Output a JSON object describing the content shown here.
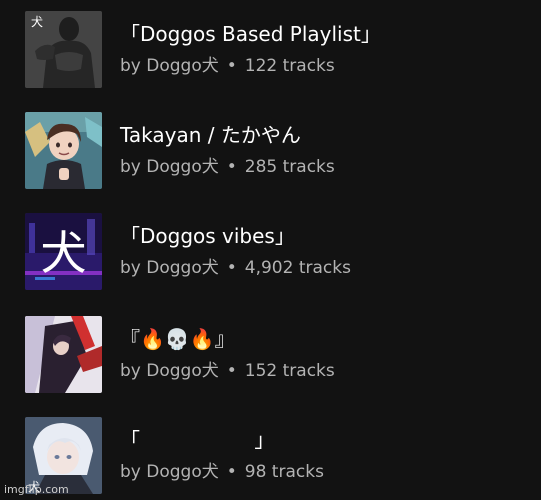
{
  "playlists": [
    {
      "title": "「Doggos Based Playlist」",
      "owner": "by Doggo犬",
      "separator": "•",
      "tracks": "122 tracks",
      "icon": "muscular-man-artwork"
    },
    {
      "title": "Takayan / たかやん",
      "owner": "by Doggo犬",
      "separator": "•",
      "tracks": "285 tracks",
      "icon": "anime-boy-artwork"
    },
    {
      "title": "「Doggos vibes」",
      "owner": "by Doggo犬",
      "separator": "•",
      "tracks": "4,902 tracks",
      "icon": "neon-kanji-artwork"
    },
    {
      "title": "『🔥💀🔥』",
      "owner": "by Doggo犬",
      "separator": "•",
      "tracks": "152 tracks",
      "icon": "chainsaw-man-artwork"
    },
    {
      "title": "「                  」",
      "owner": "by Doggo犬",
      "separator": "•",
      "tracks": "98 tracks",
      "icon": "white-haired-anime-artwork"
    }
  ],
  "watermark": "imgflip.com",
  "colors": {
    "background": "#121212",
    "title": "#ffffff",
    "meta": "#b3b3b3"
  }
}
